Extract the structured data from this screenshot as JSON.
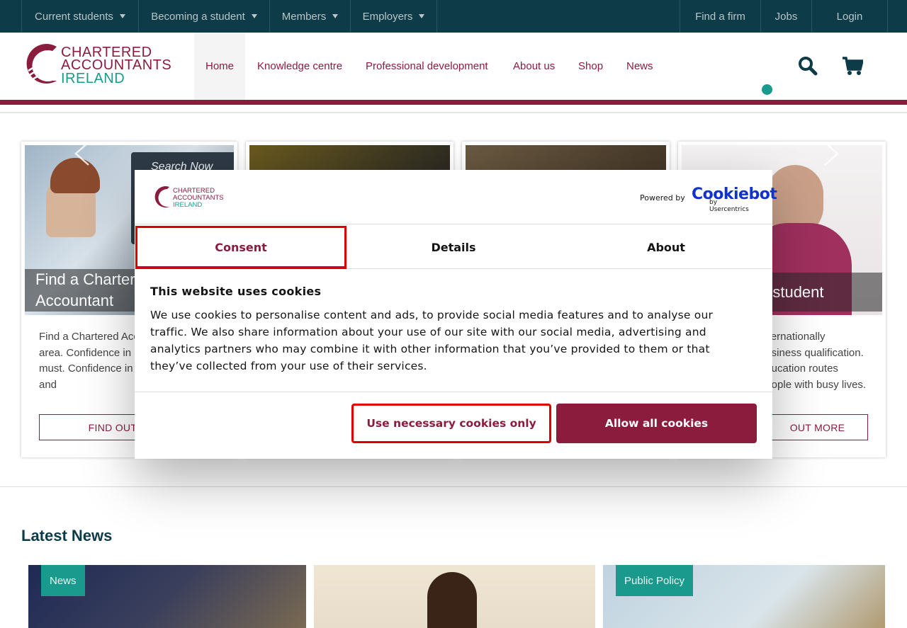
{
  "topbar": {
    "left_links": [
      "Current students",
      "Becoming a student",
      "Members",
      "Employers"
    ],
    "right_links": [
      "Find a firm",
      "Jobs",
      "Login"
    ]
  },
  "logo": {
    "line1": "CHARTERED",
    "line2": "ACCOUNTANTS",
    "line3": "IRELAND"
  },
  "nav": {
    "items": [
      "Home",
      "Knowledge centre",
      "Professional development",
      "About us",
      "Shop",
      "News"
    ],
    "active": "Home"
  },
  "icons": {
    "search": "search-icon",
    "cart": "cart-icon",
    "prev": "chevron-left-icon",
    "next": "chevron-right-icon"
  },
  "cards": [
    {
      "caption_line1": "Find a Chartered",
      "caption_line2": "Accountant",
      "desc": "Find a Chartered Accountant in your area. Confidence in business is a must. Confidence in your advisors and",
      "button": "FIND OUT MORE",
      "screen_text": "Search Now"
    },
    {
      "caption_line1": "",
      "caption_line2": "",
      "desc": "",
      "button": ""
    },
    {
      "caption_line1": "",
      "caption_line2": "",
      "desc": "",
      "button": ""
    },
    {
      "caption_line1": "",
      "caption_line2": "a student",
      "desc": "internationally business qualification. education routes people with busy lives.",
      "button": "OUT MORE"
    }
  ],
  "latest_news": {
    "heading": "Latest News",
    "items": [
      {
        "tag": "News"
      },
      {
        "tag": ""
      },
      {
        "tag": "Public Policy"
      }
    ]
  },
  "cookie_dialog": {
    "powered_by": "Powered by",
    "cookiebot": "Cookiebot",
    "by_usercentrics": "by Usercentrics",
    "tabs": [
      "Consent",
      "Details",
      "About"
    ],
    "active_tab": "Consent",
    "title": "This website uses cookies",
    "text": "We use cookies to personalise content and ads, to provide social media features and to analyse our traffic. We also share information about your use of our site with our social media, advertising and analytics partners who may combine it with other information that you’ve provided to them or that they’ve collected from your use of their services.",
    "btn_necessary": "Use necessary cookies only",
    "btn_allow": "Allow all cookies"
  },
  "colors": {
    "brand": "#8b1c3e",
    "teal": "#1a9a8c",
    "topbar": "#0d3b47"
  }
}
